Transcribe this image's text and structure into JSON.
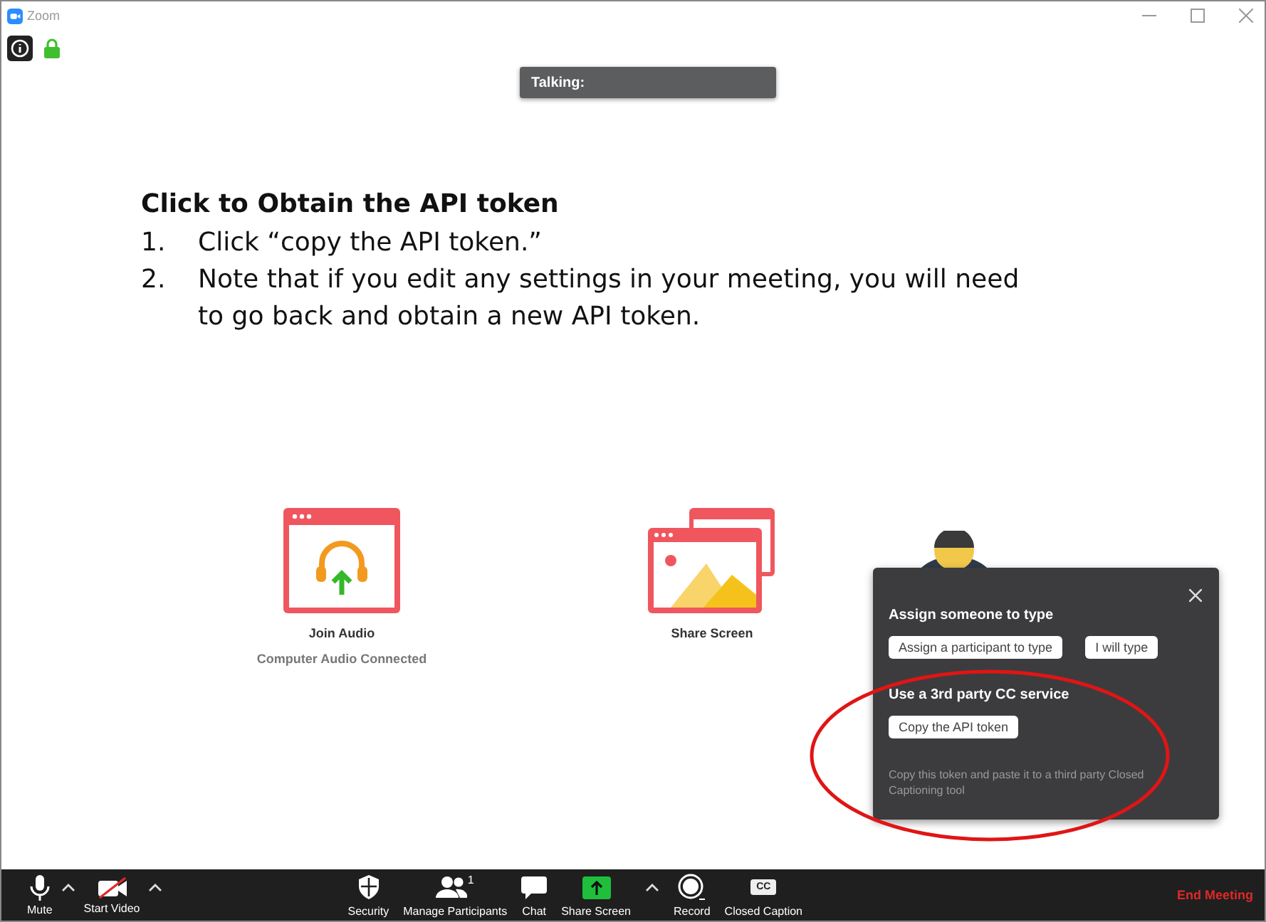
{
  "window": {
    "title": "Zoom"
  },
  "talking_indicator": {
    "label": "Talking:"
  },
  "instructions": {
    "heading": "Click to Obtain the API token",
    "steps": [
      {
        "number": "1.",
        "text": "Click “copy the API token.”"
      },
      {
        "number": "2.",
        "text": "Note that if you edit any settings in your meeting, you will need to go back and obtain a new API token."
      }
    ]
  },
  "tiles": [
    {
      "kind": "audio",
      "label": "Join Audio",
      "status": "Computer Audio Connected"
    },
    {
      "kind": "share",
      "label": "Share Screen"
    }
  ],
  "cc_popup": {
    "section_1": "Assign someone to type",
    "buttons_1": [
      "Assign a participant to type",
      "I will type"
    ],
    "section_2": "Use a 3rd party CC service",
    "button_2": "Copy the API token",
    "hint": "Copy this token and paste it to a third party Closed Captioning tool"
  },
  "toolbar": {
    "items": [
      {
        "kind": "mic",
        "label": "Mute",
        "caret": true
      },
      {
        "kind": "video",
        "label": "Start Video",
        "caret": true
      },
      {
        "kind": "security",
        "label": "Security",
        "caret": false
      },
      {
        "kind": "participants",
        "label": "Manage Participants",
        "badge": "1",
        "caret": false
      },
      {
        "kind": "chat",
        "label": "Chat",
        "caret": false
      },
      {
        "kind": "share",
        "label": "Share Screen",
        "caret": true
      },
      {
        "kind": "record",
        "label": "Record",
        "caret": false
      },
      {
        "kind": "cc",
        "label": "Closed Caption",
        "icon_text": "CC",
        "caret": false
      }
    ],
    "end_button": "End Meeting"
  }
}
